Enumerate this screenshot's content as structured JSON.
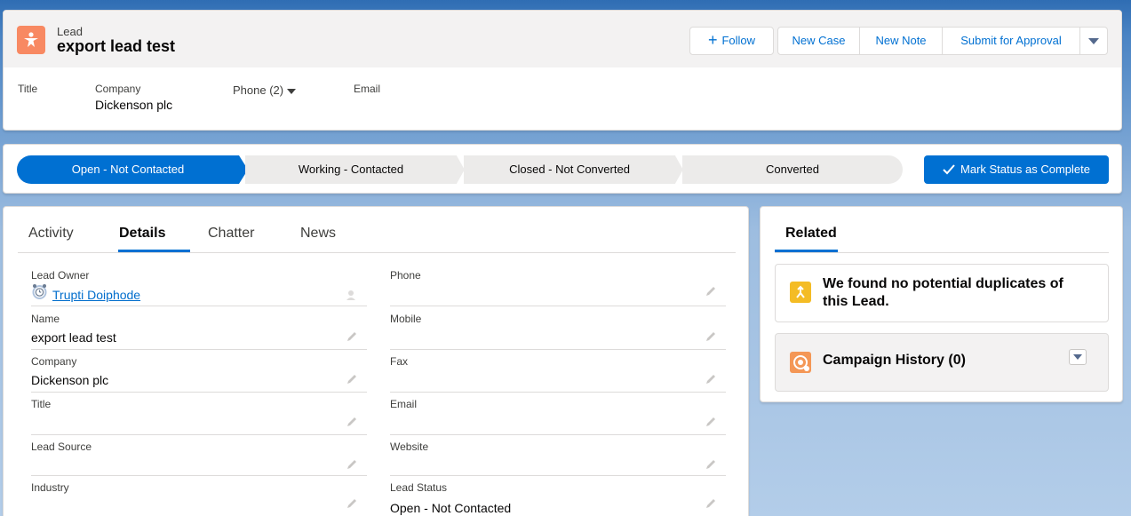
{
  "header": {
    "object_label": "Lead",
    "record_name": "export lead test",
    "buttons": {
      "follow": "Follow",
      "new_case": "New Case",
      "new_note": "New Note",
      "submit": "Submit for Approval"
    },
    "fields": {
      "title_label": "Title",
      "company_label": "Company",
      "company_value": "Dickenson plc",
      "phone_label": "Phone (2)",
      "email_label": "Email"
    }
  },
  "path": {
    "stages": [
      "Open - Not Contacted",
      "Working - Contacted",
      "Closed - Not Converted",
      "Converted"
    ],
    "mark_complete": "Mark Status as Complete"
  },
  "tabs": [
    "Activity",
    "Details",
    "Chatter",
    "News"
  ],
  "details": {
    "left": [
      {
        "label": "Lead Owner",
        "value": "Trupti Doiphode"
      },
      {
        "label": "Name",
        "value": "export lead test"
      },
      {
        "label": "Company",
        "value": "Dickenson plc"
      },
      {
        "label": "Title",
        "value": ""
      },
      {
        "label": "Lead Source",
        "value": ""
      },
      {
        "label": "Industry",
        "value": ""
      }
    ],
    "right": [
      {
        "label": "Phone",
        "value": ""
      },
      {
        "label": "Mobile",
        "value": ""
      },
      {
        "label": "Fax",
        "value": ""
      },
      {
        "label": "Email",
        "value": ""
      },
      {
        "label": "Website",
        "value": ""
      },
      {
        "label": "Lead Status",
        "value": "Open - Not Contacted"
      }
    ]
  },
  "related": {
    "tab": "Related",
    "duplicates_message": "We found no potential duplicates of this Lead.",
    "campaign_history": "Campaign History (0)"
  },
  "colors": {
    "brand_blue": "#0070d2",
    "lead_icon": "#f88962",
    "duplicate_icon": "#f4bc25",
    "campaign_icon": "#f49756"
  }
}
